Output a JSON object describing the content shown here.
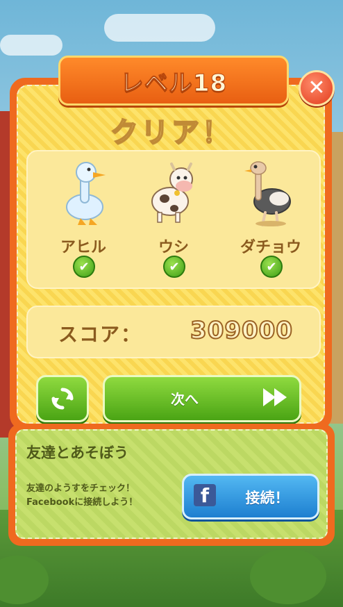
{
  "dialog": {
    "level_title": "レベル18",
    "close_label": "✕",
    "clear_text": "クリア！"
  },
  "animals": [
    {
      "name": "アヒル",
      "icon": "duck-icon",
      "cleared": true
    },
    {
      "name": "ウシ",
      "icon": "cow-icon",
      "cleared": true
    },
    {
      "name": "ダチョウ",
      "icon": "ostrich-icon",
      "cleared": true
    }
  ],
  "score": {
    "label": "スコア：",
    "value": "309000"
  },
  "buttons": {
    "replay_icon": "replay-icon",
    "next_label": "次へ",
    "next_icon": "fast-forward-icon"
  },
  "friends": {
    "title": "友達とあそぼう",
    "desc_line1": "友達のようすをチェック！",
    "desc_line2": "Facebookに接続しよう！",
    "connect_label": "接続！",
    "fb_logo": "f"
  },
  "colors": {
    "panel_orange": "#ef6a1f",
    "panel_yellow": "#fde36b",
    "button_green": "#4aa414",
    "button_blue": "#1d7fd0"
  }
}
